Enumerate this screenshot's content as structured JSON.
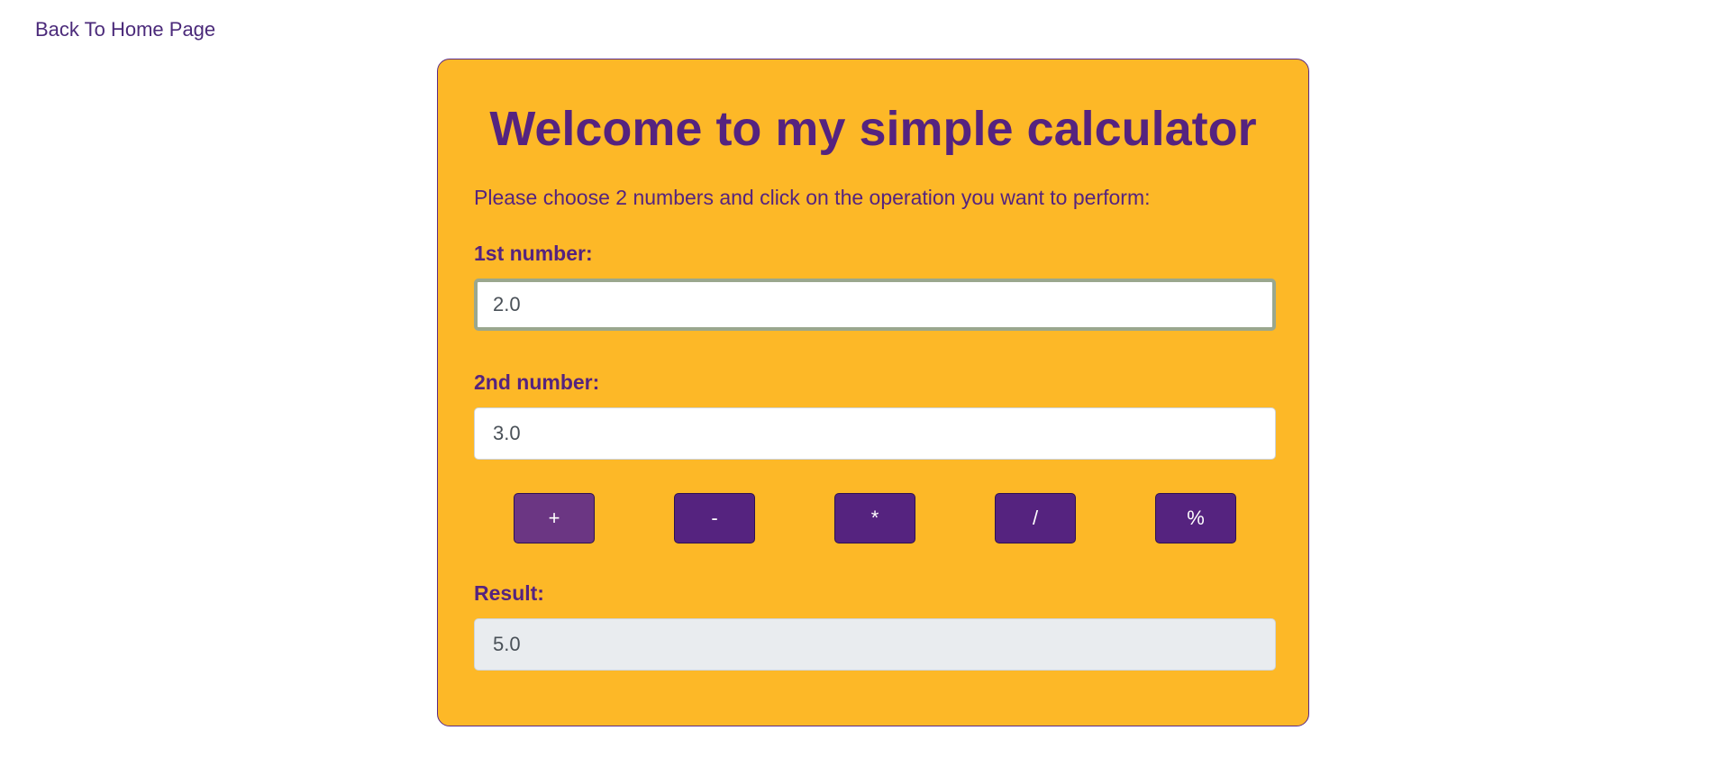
{
  "nav": {
    "back_link": "Back To Home Page"
  },
  "calculator": {
    "title": "Welcome to my simple calculator",
    "instructions": "Please choose 2 numbers and click on the operation you want to perform:",
    "first": {
      "label": "1st number:",
      "value": "2.0"
    },
    "second": {
      "label": "2nd number:",
      "value": "3.0"
    },
    "operations": {
      "add": "+",
      "subtract": "-",
      "multiply": "*",
      "divide": "/",
      "modulo": "%"
    },
    "result": {
      "label": "Result:",
      "value": "5.0"
    }
  },
  "colors": {
    "card_background": "#fdb827",
    "accent_purple": "#55237f",
    "button_hover": "#6b3683",
    "focus_ring": "#9aa78e"
  }
}
